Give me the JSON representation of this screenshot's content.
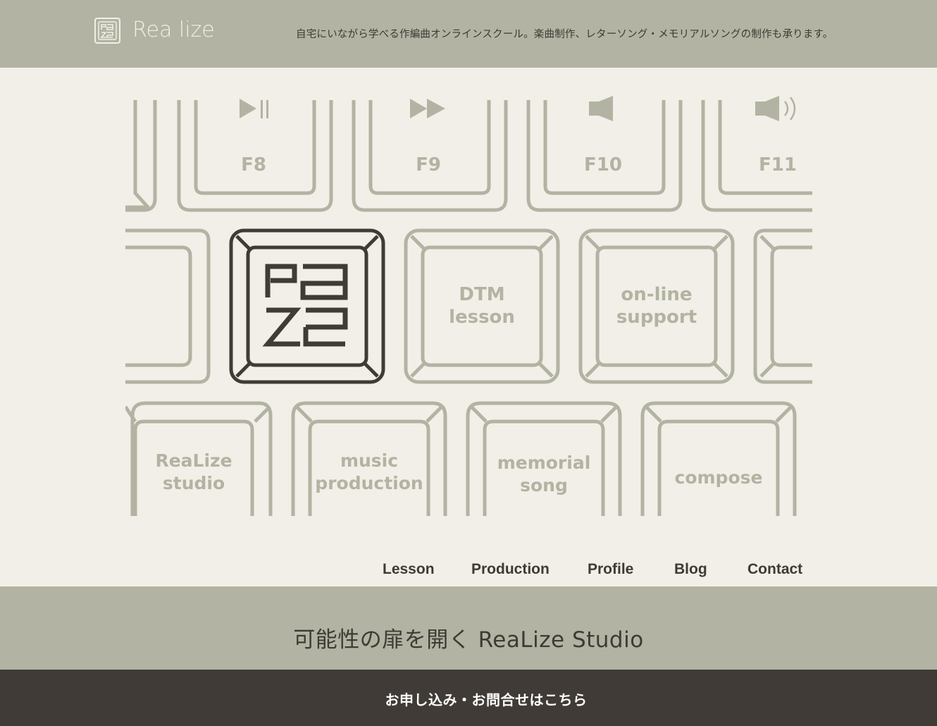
{
  "header": {
    "brand": "Rea lize",
    "tagline": "自宅にいながら学べる作編曲オンラインスクール。楽曲制作、レターソング・メモリアルソングの制作も承ります。"
  },
  "hero": {
    "fkeys": [
      "F8",
      "F9",
      "F10",
      "F11"
    ],
    "row2": [
      {
        "line1": "DTM",
        "line2": "lesson"
      },
      {
        "line1": "on-line",
        "line2": "support"
      }
    ],
    "row3": [
      {
        "line1": "ReaLize",
        "line2": "studio"
      },
      {
        "line1": "music",
        "line2": "production"
      },
      {
        "line1": "memorial",
        "line2": "song"
      },
      {
        "line1": "compose",
        "line2": ""
      }
    ]
  },
  "nav": {
    "items": [
      "Lesson",
      "Production",
      "Profile",
      "Blog",
      "Contact"
    ]
  },
  "band": {
    "title": "可能性の扉を開く ReaLize Studio"
  },
  "footer": {
    "label": "お申し込み・お問合せはこちら"
  },
  "colors": {
    "sage": "#b2b3a2",
    "cream": "#f1efe7",
    "dark": "#403b36"
  }
}
